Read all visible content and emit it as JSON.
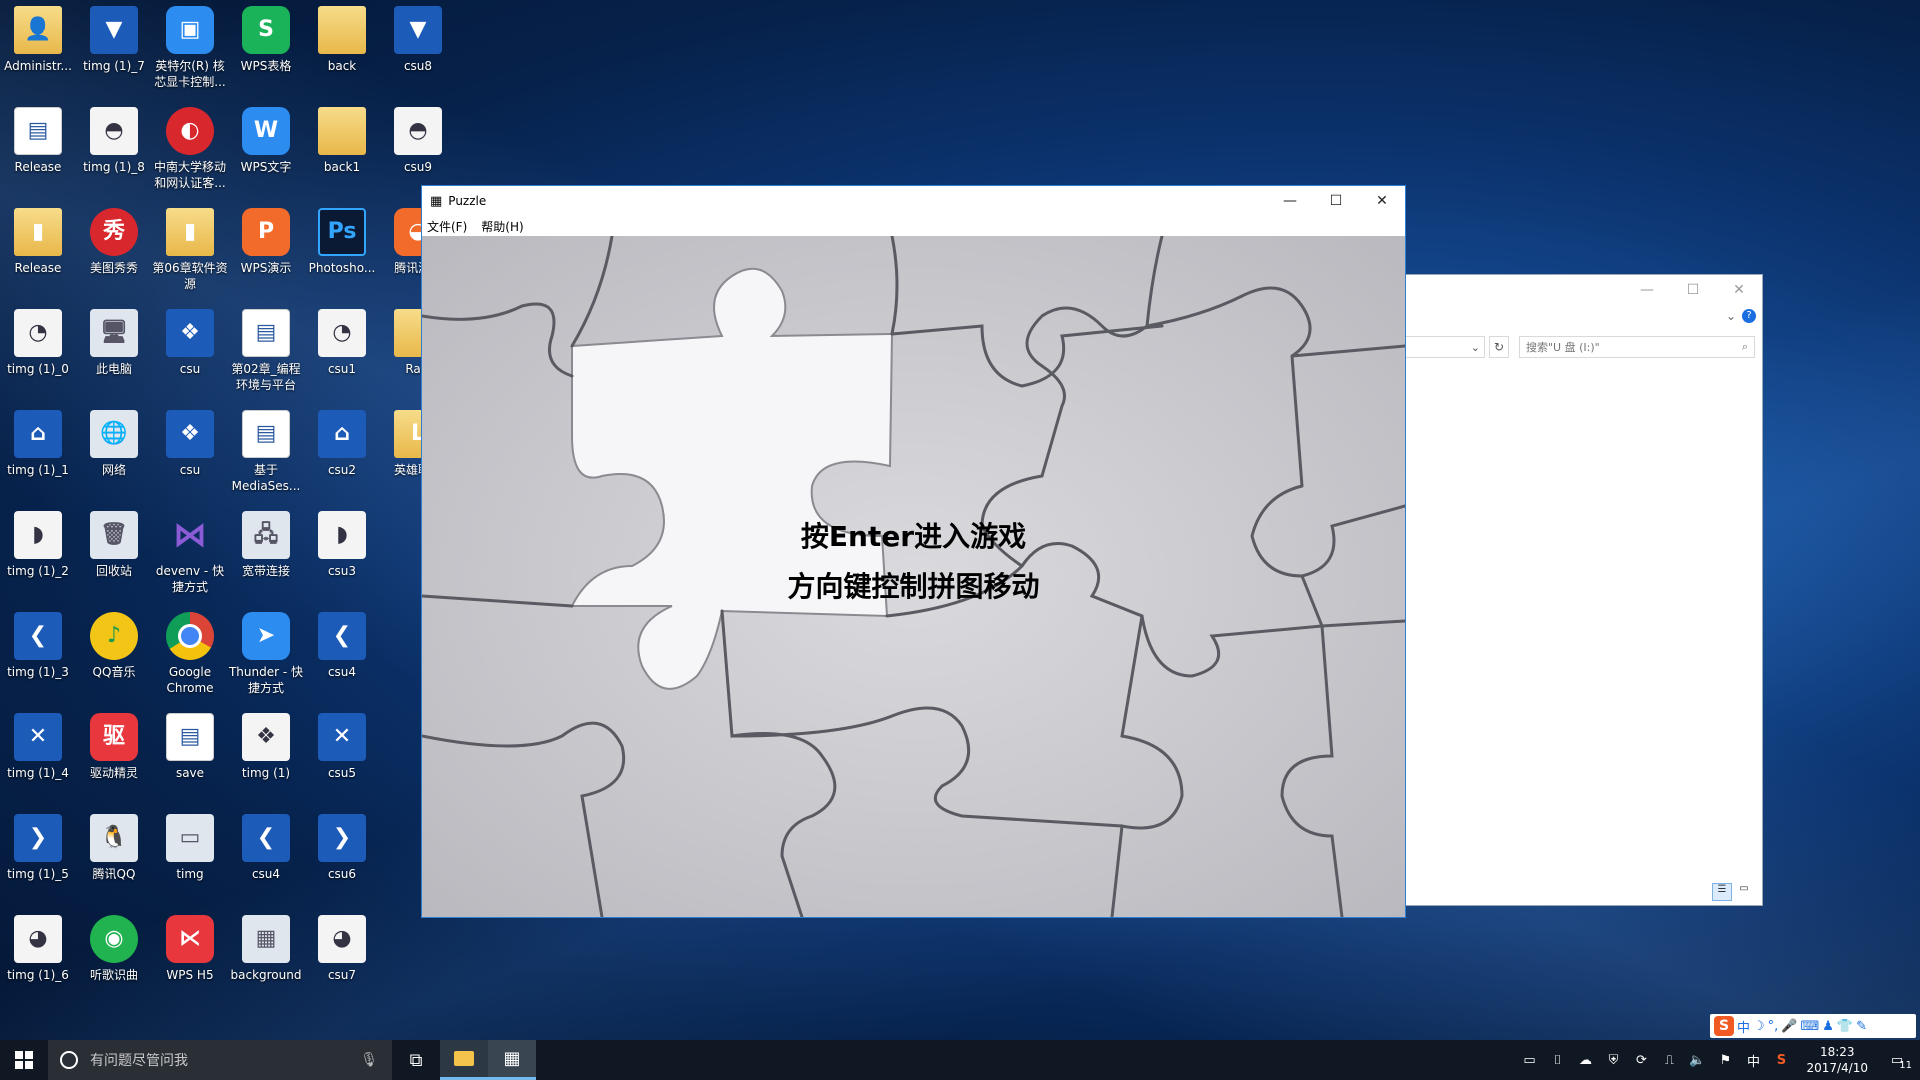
{
  "desktop": {
    "icons": [
      {
        "label": "Administr...",
        "glyph": "👤",
        "cls": "folder",
        "col": 0,
        "row": 0
      },
      {
        "label": "Release",
        "glyph": "▤",
        "cls": "doc",
        "col": 0,
        "row": 1
      },
      {
        "label": "Release",
        "glyph": "▮",
        "cls": "folder",
        "col": 0,
        "row": 2
      },
      {
        "label": "timg (1)_0",
        "glyph": "◔",
        "cls": "white",
        "col": 0,
        "row": 3
      },
      {
        "label": "timg (1)_1",
        "glyph": "⌂",
        "cls": "blue",
        "col": 0,
        "row": 4
      },
      {
        "label": "timg (1)_2",
        "glyph": "◗",
        "cls": "white",
        "col": 0,
        "row": 5
      },
      {
        "label": "timg (1)_3",
        "glyph": "❮",
        "cls": "blue",
        "col": 0,
        "row": 6
      },
      {
        "label": "timg (1)_4",
        "glyph": "✕",
        "cls": "blue",
        "col": 0,
        "row": 7
      },
      {
        "label": "timg (1)_5",
        "glyph": "❯",
        "cls": "blue",
        "col": 0,
        "row": 8
      },
      {
        "label": "timg (1)_6",
        "glyph": "◕",
        "cls": "white",
        "col": 0,
        "row": 9
      },
      {
        "label": "timg (1)_7",
        "glyph": "▼",
        "cls": "blue",
        "col": 1,
        "row": 0
      },
      {
        "label": "timg (1)_8",
        "glyph": "◓",
        "cls": "white",
        "col": 1,
        "row": 1
      },
      {
        "label": "美图秀秀",
        "glyph": "秀",
        "cls": "red",
        "col": 1,
        "row": 2
      },
      {
        "label": "此电脑",
        "glyph": "🖥",
        "cls": "plain",
        "col": 1,
        "row": 3
      },
      {
        "label": "网络",
        "glyph": "🌐",
        "cls": "plain",
        "col": 1,
        "row": 4
      },
      {
        "label": "回收站",
        "glyph": "🗑",
        "cls": "plain",
        "col": 1,
        "row": 5
      },
      {
        "label": "QQ音乐",
        "glyph": "♪",
        "cls": "yellow-round",
        "col": 1,
        "row": 6
      },
      {
        "label": "驱动精灵",
        "glyph": "驱",
        "cls": "wps-r",
        "col": 1,
        "row": 7
      },
      {
        "label": "腾讯QQ",
        "glyph": "🐧",
        "cls": "plain",
        "col": 1,
        "row": 8
      },
      {
        "label": "听歌识曲",
        "glyph": "◉",
        "cls": "green-round",
        "col": 1,
        "row": 9
      },
      {
        "label": "英特尔(R) 核芯显卡控制...",
        "glyph": "▣",
        "cls": "wps-b",
        "col": 2,
        "row": 0
      },
      {
        "label": "中南大学移动和网认证客...",
        "glyph": "◐",
        "cls": "red",
        "col": 2,
        "row": 1
      },
      {
        "label": "第06章软件资源",
        "glyph": "▮",
        "cls": "folder",
        "col": 2,
        "row": 2
      },
      {
        "label": "csu",
        "glyph": "❖",
        "cls": "blue",
        "col": 2,
        "row": 3
      },
      {
        "label": "csu",
        "glyph": "❖",
        "cls": "blue",
        "col": 2,
        "row": 4
      },
      {
        "label": "devenv - 快捷方式",
        "glyph": "⋈",
        "cls": "vs",
        "col": 2,
        "row": 5
      },
      {
        "label": "Google Chrome",
        "glyph": "",
        "cls": "chrome",
        "col": 2,
        "row": 6
      },
      {
        "label": "save",
        "glyph": "▤",
        "cls": "doc",
        "col": 2,
        "row": 7
      },
      {
        "label": "timg",
        "glyph": "▭",
        "cls": "plain",
        "col": 2,
        "row": 8
      },
      {
        "label": "WPS H5",
        "glyph": "⋉",
        "cls": "wps-r",
        "col": 2,
        "row": 9
      },
      {
        "label": "WPS表格",
        "glyph": "S",
        "cls": "wps-g",
        "col": 3,
        "row": 0
      },
      {
        "label": "WPS文字",
        "glyph": "W",
        "cls": "wps-b",
        "col": 3,
        "row": 1
      },
      {
        "label": "WPS演示",
        "glyph": "P",
        "cls": "wps-o",
        "col": 3,
        "row": 2
      },
      {
        "label": "第02章_编程环境与平台",
        "glyph": "▤",
        "cls": "doc",
        "col": 3,
        "row": 3
      },
      {
        "label": "基于MediaSes...",
        "glyph": "▤",
        "cls": "doc",
        "col": 3,
        "row": 4
      },
      {
        "label": "宽带连接",
        "glyph": "🖧",
        "cls": "plain",
        "col": 3,
        "row": 5
      },
      {
        "label": "Thunder - 快捷方式",
        "glyph": "➤",
        "cls": "wps-b",
        "col": 3,
        "row": 6
      },
      {
        "label": "timg (1)",
        "glyph": "❖",
        "cls": "white",
        "col": 3,
        "row": 7
      },
      {
        "label": "csu4",
        "glyph": "❮",
        "cls": "blue",
        "col": 3,
        "row": 8
      },
      {
        "label": "background",
        "glyph": "▦",
        "cls": "plain",
        "col": 3,
        "row": 9
      },
      {
        "label": "back",
        "glyph": "",
        "cls": "folder",
        "col": 4,
        "row": 0
      },
      {
        "label": "back1",
        "glyph": "",
        "cls": "folder",
        "col": 4,
        "row": 1
      },
      {
        "label": "Photosho...",
        "glyph": "Ps",
        "cls": "ps",
        "col": 4,
        "row": 2
      },
      {
        "label": "csu1",
        "glyph": "◔",
        "cls": "white",
        "col": 4,
        "row": 3
      },
      {
        "label": "csu2",
        "glyph": "⌂",
        "cls": "blue",
        "col": 4,
        "row": 4
      },
      {
        "label": "csu3",
        "glyph": "◗",
        "cls": "white",
        "col": 4,
        "row": 5
      },
      {
        "label": "csu4",
        "glyph": "❮",
        "cls": "blue",
        "col": 4,
        "row": 6
      },
      {
        "label": "csu5",
        "glyph": "✕",
        "cls": "blue",
        "col": 4,
        "row": 7
      },
      {
        "label": "csu6",
        "glyph": "❯",
        "cls": "blue",
        "col": 4,
        "row": 8
      },
      {
        "label": "csu7",
        "glyph": "◕",
        "cls": "white",
        "col": 4,
        "row": 9
      },
      {
        "label": "csu8",
        "glyph": "▼",
        "cls": "blue",
        "col": 5,
        "row": 0
      },
      {
        "label": "csu9",
        "glyph": "◓",
        "cls": "white",
        "col": 5,
        "row": 1
      },
      {
        "label": "腾讯游...",
        "glyph": "◒",
        "cls": "wps-o",
        "col": 5,
        "row": 2
      },
      {
        "label": "Raic",
        "glyph": "",
        "cls": "folder",
        "col": 5,
        "row": 3
      },
      {
        "label": "英雄联盟",
        "glyph": "L",
        "cls": "folder",
        "col": 5,
        "row": 4
      }
    ]
  },
  "puzzle_window": {
    "title": "Puzzle",
    "menu": [
      "文件(F)",
      "帮助(H)"
    ],
    "line1": "按Enter进入游戏",
    "line2": "方向键控制拼图移动"
  },
  "explorer_window": {
    "search_placeholder": "搜索\"U 盘 (I:)\""
  },
  "taskbar": {
    "search_placeholder": "有问题尽管问我",
    "time": "18:23",
    "date": "2017/4/10",
    "ime_lang": "中",
    "notifications": "11"
  }
}
